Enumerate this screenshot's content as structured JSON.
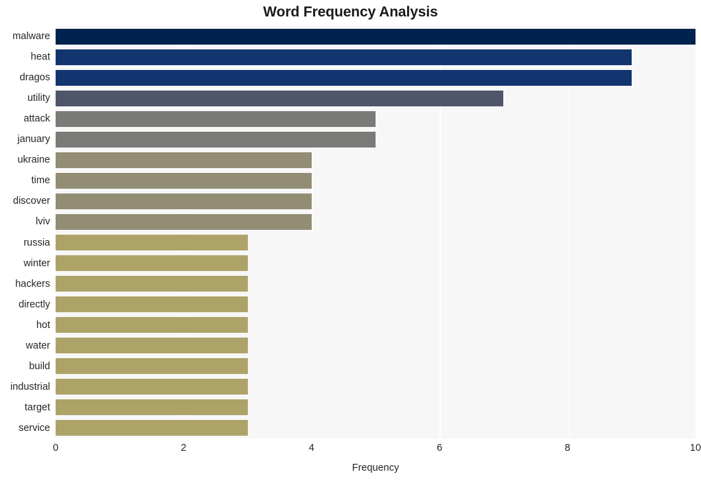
{
  "chart_data": {
    "type": "bar",
    "orientation": "horizontal",
    "title": "Word Frequency Analysis",
    "xlabel": "Frequency",
    "ylabel": "",
    "xlim": [
      0,
      10
    ],
    "xticks": [
      0,
      2,
      4,
      6,
      8,
      10
    ],
    "xtick_labels": [
      "0",
      "2",
      "4",
      "6",
      "8",
      "10"
    ],
    "grid": true,
    "grid_axis": "x",
    "legend": "none",
    "plot_background": "#f7f7f7",
    "figure_background": "#ffffff",
    "categories": [
      "malware",
      "heat",
      "dragos",
      "utility",
      "attack",
      "january",
      "ukraine",
      "time",
      "discover",
      "lviv",
      "russia",
      "winter",
      "hackers",
      "directly",
      "hot",
      "water",
      "build",
      "industrial",
      "target",
      "service"
    ],
    "values": [
      10,
      9,
      9,
      7,
      5,
      5,
      4,
      4,
      4,
      4,
      3,
      3,
      3,
      3,
      3,
      3,
      3,
      3,
      3,
      3
    ],
    "bar_colors": [
      "#00224e",
      "#123570",
      "#123570",
      "#4f566b",
      "#7a7a77",
      "#7a7a77",
      "#938d74",
      "#938d74",
      "#938d74",
      "#938d74",
      "#ada369",
      "#ada369",
      "#ada369",
      "#ada369",
      "#ada369",
      "#ada369",
      "#ada369",
      "#ada369",
      "#ada369",
      "#ada369"
    ]
  }
}
